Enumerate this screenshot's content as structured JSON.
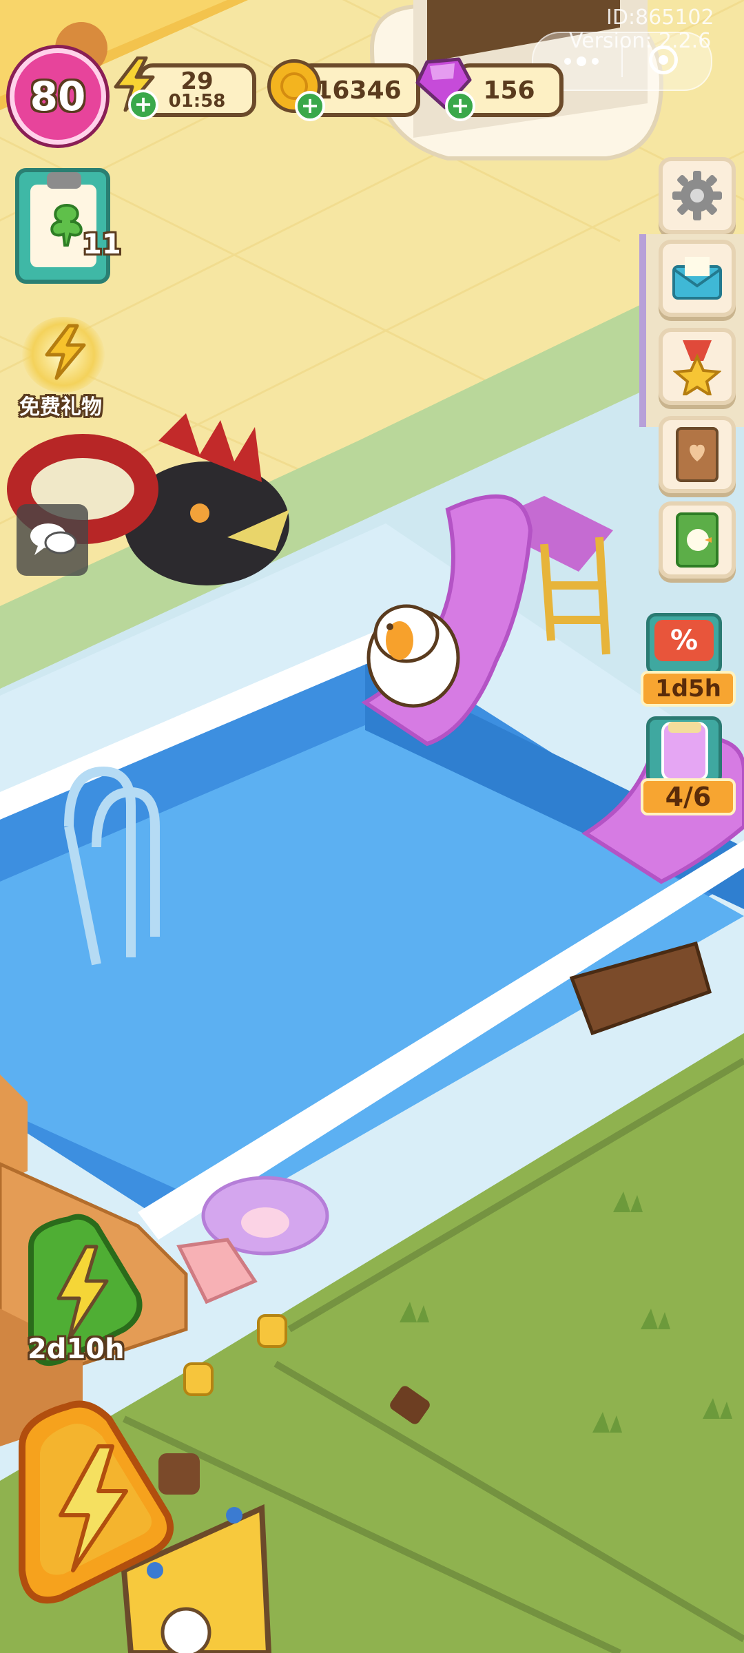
{
  "hud": {
    "level": "80",
    "energy": {
      "value": "29",
      "timer": "01:58"
    },
    "coins": "16346",
    "gems": "156"
  },
  "overlay": {
    "id_text": "ID:865102",
    "version_text": "Version: 2.2.6"
  },
  "left_panel": {
    "task_count": "11",
    "free_gift_label": "免费礼物"
  },
  "right_panel": {
    "sale_timer": "1d5h",
    "jar_progress": "4/6"
  },
  "bottom": {
    "boost_timer": "2d10h"
  },
  "icons": {
    "settings": "gear-icon",
    "mail": "mail-icon",
    "achievements": "medal-star-icon",
    "album": "heart-book-icon",
    "guide": "duck-book-icon",
    "chat": "chat-bubbles-icon",
    "menu": "more-dots-icon",
    "target": "target-circle-icon",
    "energy": "lightning-icon",
    "coin": "coin-icon",
    "gem": "gem-icon",
    "plus": "plus-icon"
  },
  "colors": {
    "floor": "#f8e8a6",
    "grass": "#8fb24f",
    "pool_water": "#4aa3ee",
    "pool_tile": "#d7eef8",
    "slide": "#d86fe0",
    "hud_border": "#6b4a2a"
  }
}
